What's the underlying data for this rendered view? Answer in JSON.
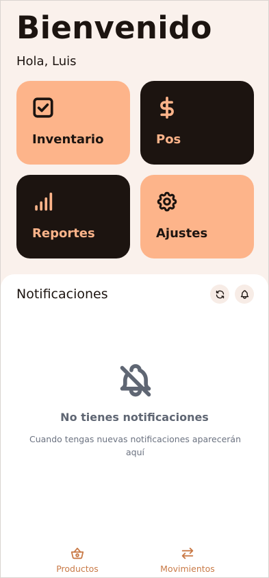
{
  "header": {
    "title": "Bienvenido",
    "greeting": "Hola, Luis"
  },
  "menu": {
    "items": [
      {
        "label": "Inventario",
        "icon": "checkbox-icon",
        "theme": "light"
      },
      {
        "label": "Pos",
        "icon": "dollar-icon",
        "theme": "dark"
      },
      {
        "label": "Reportes",
        "icon": "bar-chart-icon",
        "theme": "dark"
      },
      {
        "label": "Ajustes",
        "icon": "gear-icon",
        "theme": "light"
      }
    ]
  },
  "notifications": {
    "title": "Notificaciones",
    "refresh_icon": "refresh-icon",
    "bell_icon": "bell-icon",
    "empty_icon": "bell-off-icon",
    "empty_title": "No tienes notificaciones",
    "empty_text": "Cuando tengas nuevas notificaciones aparecerán aquí"
  },
  "bottom_nav": {
    "items": [
      {
        "label": "Productos",
        "icon": "basket-icon"
      },
      {
        "label": "Movimientos",
        "icon": "arrows-exchange-icon"
      }
    ]
  },
  "colors": {
    "background": "#faf1ec",
    "accent": "#fdb48a",
    "dark": "#1c1410",
    "nav_accent": "#c97a47"
  }
}
